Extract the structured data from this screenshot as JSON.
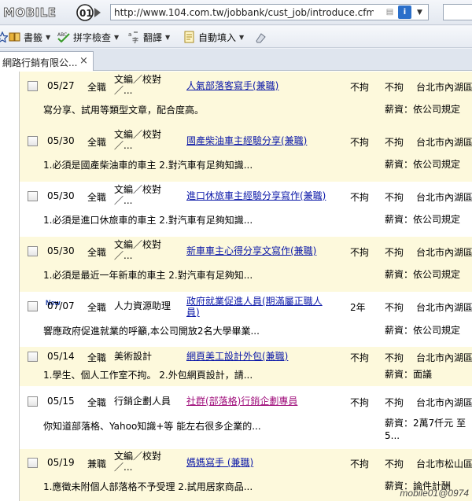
{
  "browser": {
    "logo_text": "MOBILE01",
    "url": "http://www.104.com.tw/jobbank/cust_job/introduce.cfm?j=3f",
    "toolbar": {
      "bookmarks": "書籤",
      "spellcheck": "拼字檢查",
      "translate": "翻譯",
      "autofill": "自動填入"
    },
    "tab_title": "網路行銷有限公...",
    "tab_close": "×"
  },
  "jobs": [
    {
      "date": "05/27",
      "new": "",
      "type": "全職",
      "category": [
        "文編／校對",
        "／..."
      ],
      "title": [
        "人氣部落客寫手(兼職)"
      ],
      "experience": "不拘",
      "education": "不拘",
      "location": "台北市內湖區",
      "description": "寫分享、試用等類型文章，配合度高。",
      "salary": [
        "薪資：依公司規定"
      ]
    },
    {
      "date": "05/30",
      "new": "",
      "type": "全職",
      "category": [
        "文編／校對",
        "／..."
      ],
      "title": [
        "國產柴油車主經驗分享(兼職)"
      ],
      "experience": "不拘",
      "education": "不拘",
      "location": "台北市內湖區",
      "description": "1.必須是國產柴油車的車主 2.對汽車有足夠知識...",
      "salary": [
        "薪資：依公司規定"
      ]
    },
    {
      "date": "05/30",
      "new": "",
      "type": "全職",
      "category": [
        "文編／校對",
        "／..."
      ],
      "title": [
        "進口休旅車主經驗分享寫作(兼職)"
      ],
      "experience": "不拘",
      "education": "不拘",
      "location": "台北市內湖區",
      "description": "1.必須是進口休旅車的車主 2.對汽車有足夠知識...",
      "salary": [
        "薪資：依公司規定"
      ]
    },
    {
      "date": "05/30",
      "new": "",
      "type": "全職",
      "category": [
        "文編／校對",
        "／..."
      ],
      "title": [
        "新車車主心得分享文寫作(兼職)"
      ],
      "experience": "不拘",
      "education": "不拘",
      "location": "台北市內湖區",
      "description": "1.必須是最近一年新車的車主 2.對汽車有足夠知...",
      "salary": [
        "薪資：依公司規定"
      ]
    },
    {
      "date": "07/07",
      "new": "New",
      "type": "全職",
      "category": [
        "人力資源助理"
      ],
      "title": [
        "政府就業促進人員(期滿屬正職人",
        "員)"
      ],
      "experience": "2年",
      "education": "不拘",
      "location": "台北市內湖區",
      "description": "響應政府促進就業的呼籲,本公司開放2名大學畢業...",
      "salary": [
        "薪資：依公司規定"
      ]
    },
    {
      "date": "05/14",
      "new": "",
      "type": "全職",
      "category": [
        "美術設計"
      ],
      "title": [
        "網頁美工設計外包(兼職)"
      ],
      "experience": "不拘",
      "education": "不拘",
      "location": "台北市內湖區",
      "description": "1.學生、個人工作室不拘。 2.外包網頁設計，請...",
      "salary": [
        "薪資：面議"
      ]
    },
    {
      "date": "05/15",
      "new": "",
      "type": "全職",
      "category": [
        "行銷企劃人員"
      ],
      "title": [
        "社群(部落格)行銷企劃專員"
      ],
      "experience": "不拘",
      "education": "不拘",
      "location": "台北市內湖區",
      "description": "你知道部落格、Yahoo知識+等 能左右很多企業的...",
      "salary": [
        "薪資：2萬7仟元 至",
        "5..."
      ]
    },
    {
      "date": "05/19",
      "new": "",
      "type": "兼職",
      "category": [
        "文編／校對",
        "／..."
      ],
      "title": [
        "媽媽寫手 (兼職)"
      ],
      "experience": "不拘",
      "education": "不拘",
      "location": "台北市松山區",
      "description": "1.應徵未附個人部落格不予受理 2.試用居家商品...",
      "salary": [
        "薪資：論件計酬"
      ]
    }
  ],
  "watermark": "mobile01@0974",
  "colors": {
    "highlight_row": "#fdf9dc",
    "link_blue": "#0b18a8",
    "link_visited": "#a0107c",
    "chrome": "#eef1f6"
  },
  "icons": [
    "star-icon",
    "book-icon",
    "spellcheck-icon",
    "translate-icon",
    "autofill-icon",
    "eraser-icon",
    "page-icon",
    "info-icon",
    "close-icon"
  ]
}
